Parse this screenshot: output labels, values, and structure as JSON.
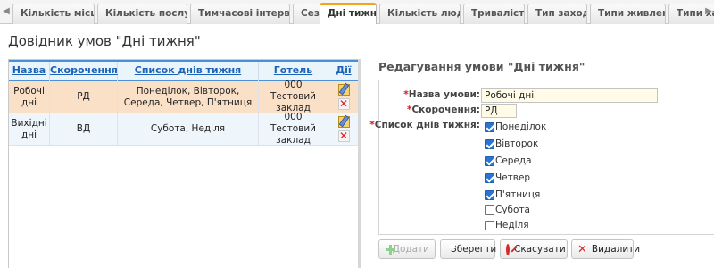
{
  "tabs": [
    {
      "label": "Кількість місць",
      "active": false
    },
    {
      "label": "Кількість послуг",
      "active": false
    },
    {
      "label": "Тимчасові інтервали",
      "active": false
    },
    {
      "label": "Сезони",
      "active": false
    },
    {
      "label": "Дні тижня",
      "active": true
    },
    {
      "label": "Кількість людей",
      "active": false
    },
    {
      "label": "Тривалість",
      "active": false
    },
    {
      "label": "Тип заходу",
      "active": false
    },
    {
      "label": "Типи живлення",
      "active": false
    },
    {
      "label": "Типи хар",
      "active": false
    }
  ],
  "page_title": "Довідник умов \"Дні тижня\"",
  "table": {
    "headers": {
      "name": "Назва",
      "abbr": "Скорочення",
      "days": "Список днів тижня",
      "hotel": "Готель",
      "actions": "Дії"
    },
    "rows": [
      {
        "name": "Робочі дні",
        "abbr": "РД",
        "days": "Понеділок, Вівторок, Середа, Четвер, П'ятниця",
        "hotel": "000 Тестовий заклад",
        "selected": true
      },
      {
        "name": "Вихідні дні",
        "abbr": "ВД",
        "days": "Субота, Неділя",
        "hotel": "000 Тестовий заклад",
        "selected": false
      }
    ]
  },
  "edit": {
    "title": "Редагування умови \"Дні тижня\"",
    "required_mark": "*",
    "name_label": "Назва умови:",
    "name_value": "Робочі дні",
    "abbr_label": "Скорочення:",
    "abbr_value": "РД",
    "days_label": "Список днів тижня:",
    "days": [
      {
        "label": "Понеділок",
        "checked": true
      },
      {
        "label": "Вівторок",
        "checked": true
      },
      {
        "label": "Середа",
        "checked": true
      },
      {
        "label": "Четвер",
        "checked": true
      },
      {
        "label": "П'ятниця",
        "checked": true
      },
      {
        "label": "Субота",
        "checked": false
      },
      {
        "label": "Неділя",
        "checked": false
      }
    ]
  },
  "buttons": {
    "add": "Додати",
    "save": "Зберегти",
    "cancel": "Скасувати",
    "delete": "Видалити"
  }
}
